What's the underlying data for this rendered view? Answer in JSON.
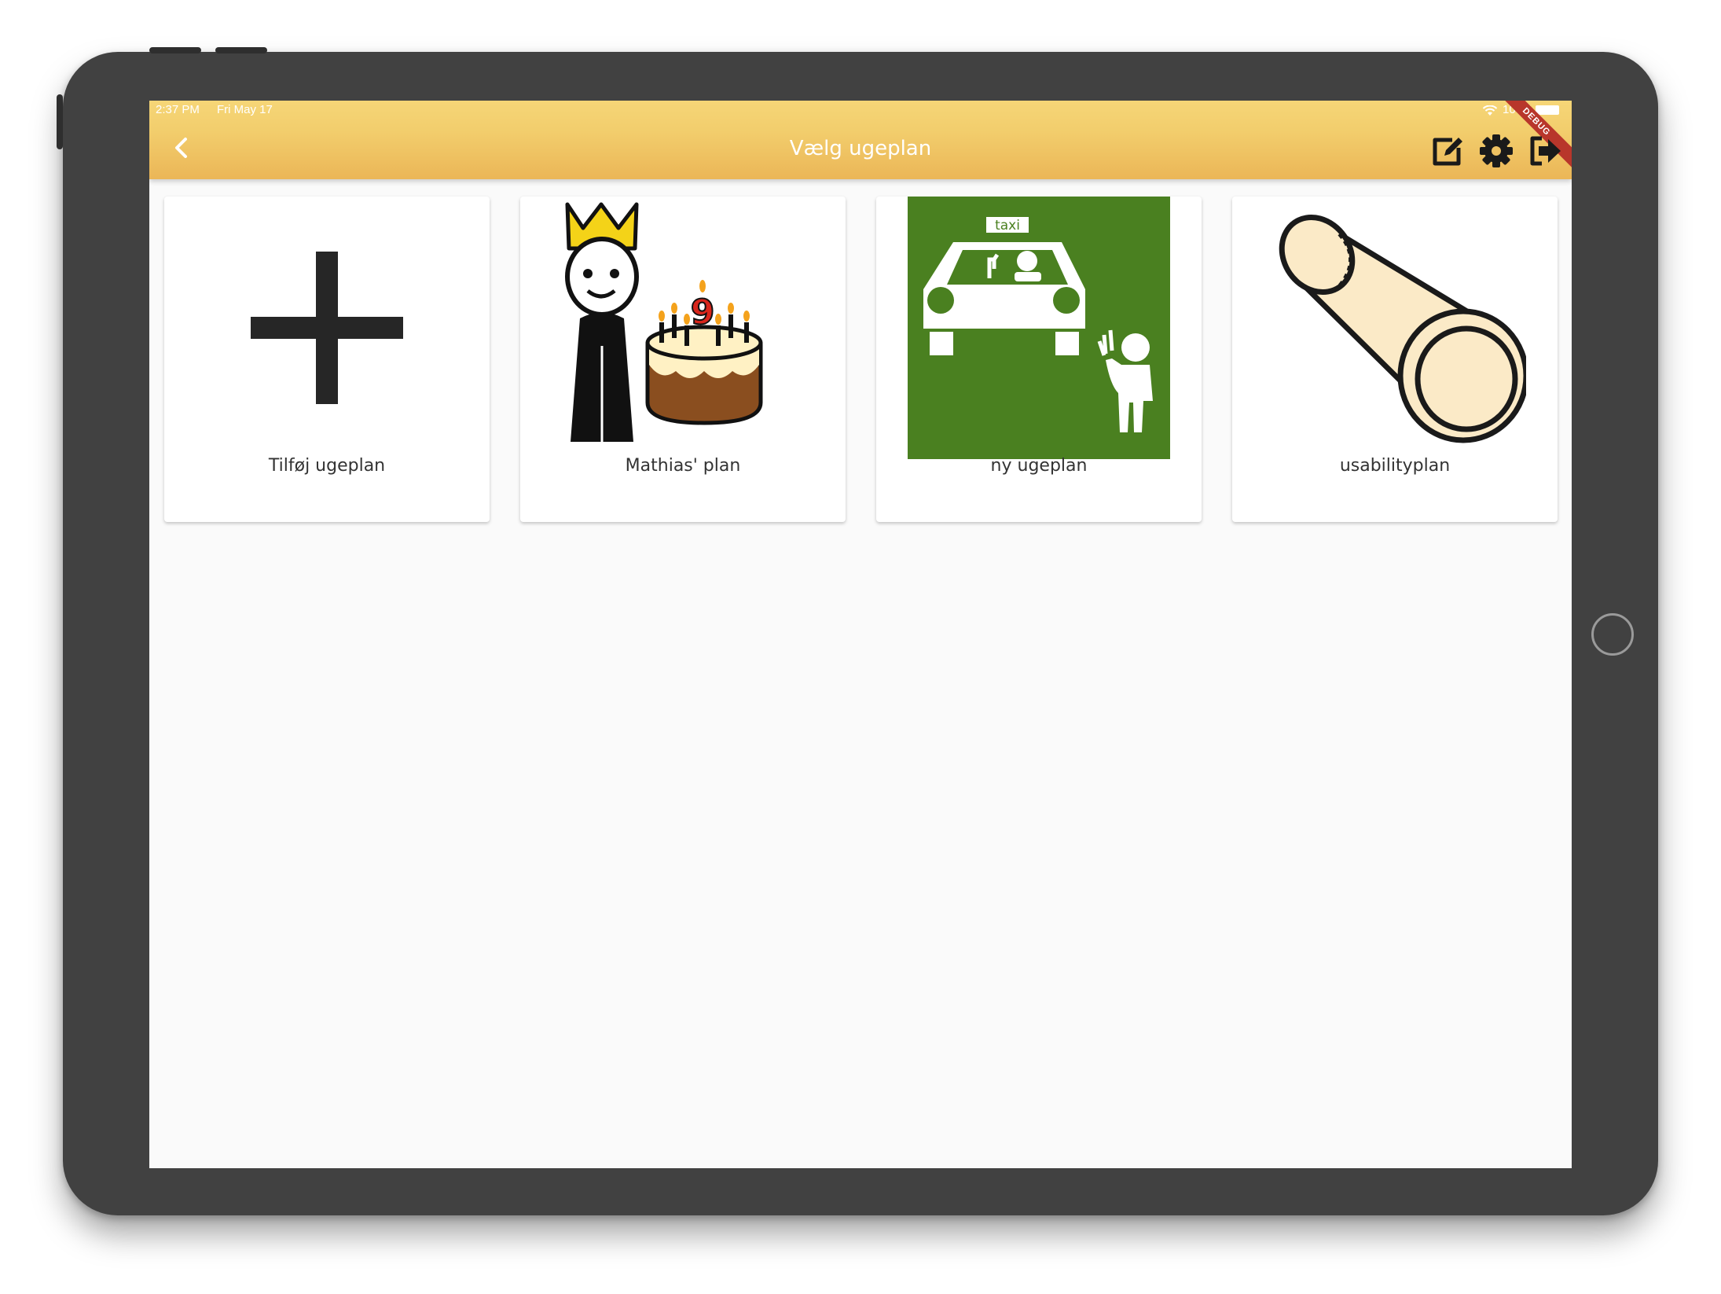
{
  "status_bar": {
    "time": "2:37 PM",
    "date": "Fri May 17",
    "battery": "100%",
    "debug_banner": "DEBUG"
  },
  "app_bar": {
    "title": "Vælg ugeplan",
    "back_icon": "chevron-left-icon",
    "actions": [
      "edit-icon",
      "gear-icon",
      "logout-icon"
    ]
  },
  "cards": [
    {
      "label": "Tilføj ugeplan",
      "icon": "plus-icon"
    },
    {
      "label": "Mathias' plan",
      "icon": "king-birthday-cake-picture"
    },
    {
      "label": "ny ugeplan",
      "icon": "taxi-picture"
    },
    {
      "label": "usabilityplan",
      "icon": "cylinder-picture"
    }
  ],
  "cake_number": "9",
  "taxi_sign": "taxi",
  "colors": {
    "app_bar_top": "#f6d677",
    "app_bar_bottom": "#ebb657",
    "taxi_green": "#4a8020",
    "crown_yellow": "#f4d318",
    "cylinder_fill": "#fbeac7"
  }
}
